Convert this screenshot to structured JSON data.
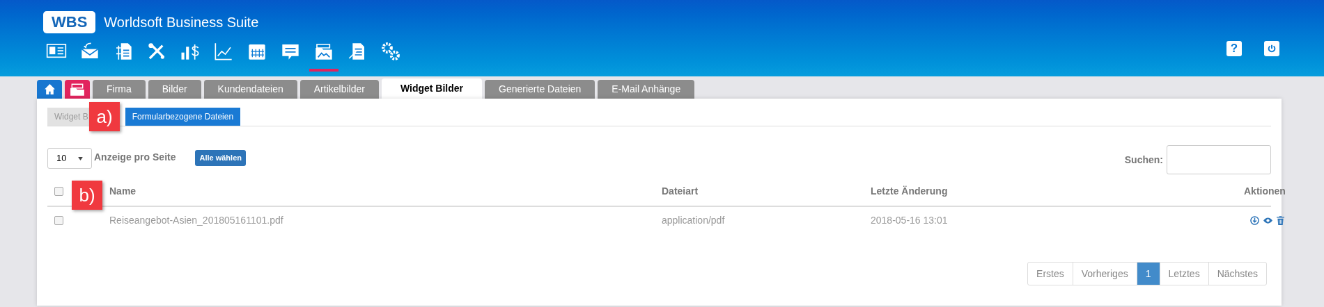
{
  "app": {
    "logo": "WBS",
    "title": "Worldsoft Business Suite"
  },
  "nav_icons": [
    {
      "kind": "card",
      "selected": false
    },
    {
      "kind": "mail",
      "selected": false
    },
    {
      "kind": "invoice",
      "selected": false
    },
    {
      "kind": "tools",
      "selected": false
    },
    {
      "kind": "revenue",
      "selected": false
    },
    {
      "kind": "chart",
      "selected": false
    },
    {
      "kind": "calendar",
      "selected": false
    },
    {
      "kind": "chat",
      "selected": false
    },
    {
      "kind": "folder",
      "selected": true
    },
    {
      "kind": "document",
      "selected": false
    },
    {
      "kind": "gears",
      "selected": false
    }
  ],
  "header_buttons": [
    {
      "kind": "help",
      "label": "?"
    },
    {
      "kind": "power"
    }
  ],
  "tabs": [
    {
      "kind": "home",
      "selected": false
    },
    {
      "kind": "images",
      "selected": false
    },
    {
      "label": "Firma",
      "selected": false
    },
    {
      "label": "Bilder",
      "selected": false
    },
    {
      "label": "Kundendateien",
      "selected": false
    },
    {
      "label": "Artikelbilder",
      "selected": false
    },
    {
      "label": "Widget Bilder",
      "selected": true
    },
    {
      "label": "Generierte Dateien",
      "selected": false
    },
    {
      "label": "E-Mail Anhänge",
      "selected": false
    }
  ],
  "subtabs": [
    {
      "label": "Widget B",
      "selected": false
    },
    {
      "label": "Formularbezogene Dateien",
      "selected": true
    }
  ],
  "annotations": [
    {
      "label": "a)"
    },
    {
      "label": "b)"
    }
  ],
  "page_size": {
    "value": "10",
    "label": "Anzeige pro Seite"
  },
  "select_all_button": "Alle wählen",
  "search": {
    "label": "Suchen:"
  },
  "table": {
    "select_all_checked": false,
    "columns": [
      "Name",
      "Dateiart",
      "Letzte Änderung",
      "Aktionen"
    ],
    "rows": [
      {
        "checked": false,
        "name": "Reiseangebot-Asien_201805161101.pdf",
        "type": "application/pdf",
        "modified": "2018-05-16 13:01"
      }
    ]
  },
  "pagination": [
    {
      "label": "Erstes",
      "selected": false
    },
    {
      "label": "Vorheriges",
      "selected": false
    },
    {
      "label": "1",
      "selected": true
    },
    {
      "label": "Letztes",
      "selected": false
    },
    {
      "label": "Nächstes",
      "selected": false
    }
  ]
}
